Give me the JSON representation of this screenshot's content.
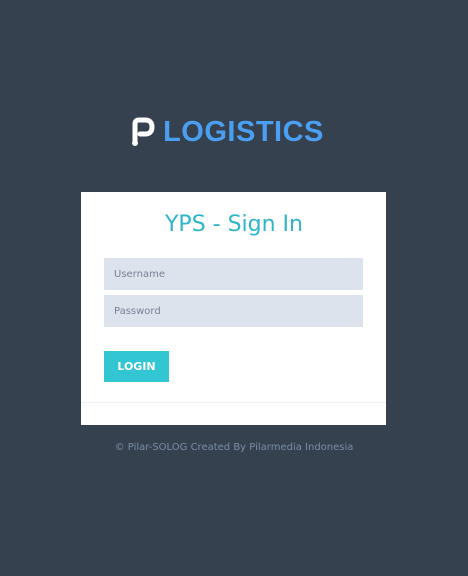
{
  "brand": {
    "logo_text": "LOGISTICS",
    "logo_color": "#4a9ff0",
    "logo_icon": "pilar-p-logo-icon"
  },
  "login": {
    "title": "YPS - Sign In",
    "username_placeholder": "Username",
    "password_placeholder": "Password",
    "login_label": "LOGIN"
  },
  "footer": {
    "copyright": "© Pilar-SOLOG Created By Pilarmedia Indonesia"
  },
  "colors": {
    "background": "#364150",
    "accent": "#32c5d2",
    "title": "#2fb5c9",
    "input_bg": "#dde3ec"
  }
}
